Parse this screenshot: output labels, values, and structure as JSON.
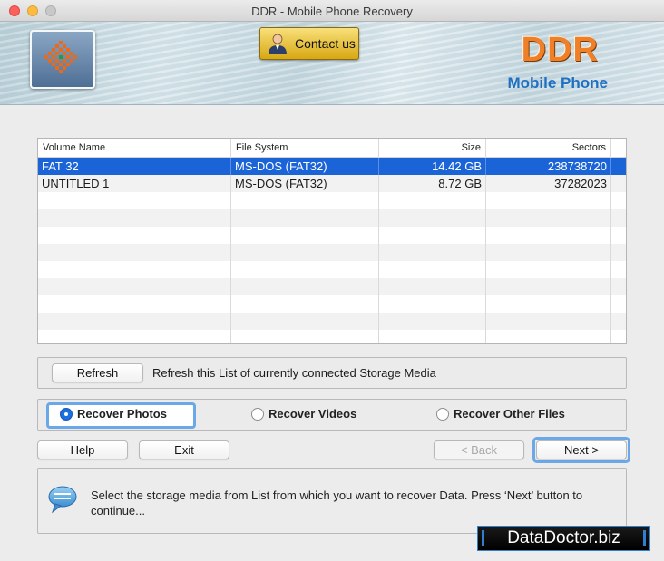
{
  "window": {
    "title": "DDR - Mobile Phone Recovery"
  },
  "banner": {
    "contact_label": "Contact us",
    "brand": "DDR",
    "brand_sub": "Mobile Phone"
  },
  "table": {
    "headers": [
      "Volume Name",
      "File System",
      "Size",
      "Sectors"
    ],
    "rows": [
      {
        "name": "FAT 32",
        "fs": "MS-DOS (FAT32)",
        "size": "14.42  GB",
        "sectors": "238738720",
        "selected": true
      },
      {
        "name": "UNTITLED 1",
        "fs": "MS-DOS (FAT32)",
        "size": "8.72  GB",
        "sectors": "37282023",
        "selected": false
      }
    ]
  },
  "refresh": {
    "button_label": "Refresh",
    "text": "Refresh this List of currently connected Storage Media"
  },
  "recover_options": {
    "photos": "Recover Photos",
    "videos": "Recover Videos",
    "other": "Recover Other Files",
    "selected": "photos"
  },
  "buttons": {
    "help": "Help",
    "exit": "Exit",
    "back": "< Back",
    "next": "Next >"
  },
  "info": {
    "text": "Select the storage media from List from which you want to recover Data. Press ‘Next’ button to continue..."
  },
  "watermark": "DataDoctor.biz",
  "colors": {
    "selection": "#1b64d8",
    "brand_orange": "#f08028",
    "brand_blue": "#1f6fc2"
  }
}
